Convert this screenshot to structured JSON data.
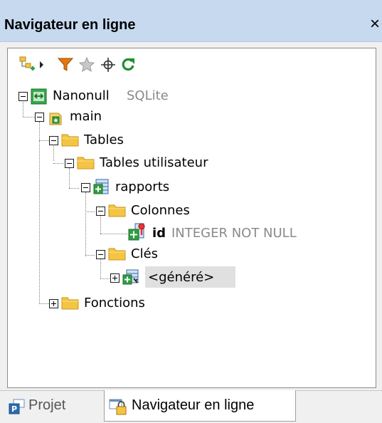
{
  "window": {
    "title": "Navigateur en ligne",
    "close_glyph": "×"
  },
  "toolbar": {
    "icons": [
      "add-object-icon",
      "dropdown-arrow-icon",
      "filter-icon",
      "favorites-star-icon",
      "locate-crosshair-icon",
      "refresh-icon"
    ]
  },
  "tree": {
    "nodes": [
      {
        "id": "nanonull",
        "label": "Nanonull",
        "suffix": "SQLite",
        "toggle": "minus",
        "icon": "database-connection-icon"
      },
      {
        "id": "main",
        "label": "main",
        "toggle": "minus",
        "icon": "schema-icon"
      },
      {
        "id": "tables",
        "label": "Tables",
        "toggle": "minus",
        "icon": "folder-icon"
      },
      {
        "id": "user-tables",
        "label": "Tables utilisateur",
        "toggle": "minus",
        "icon": "folder-icon"
      },
      {
        "id": "rapports",
        "label": "rapports",
        "toggle": "minus",
        "icon": "table-icon"
      },
      {
        "id": "colonnes",
        "label": "Colonnes",
        "toggle": "minus",
        "icon": "folder-icon"
      },
      {
        "id": "id",
        "label": "id",
        "suffix": "INTEGER NOT NULL",
        "toggle": "none",
        "icon": "primary-key-column-icon"
      },
      {
        "id": "cles",
        "label": "Clés",
        "toggle": "minus",
        "icon": "folder-icon"
      },
      {
        "id": "genere",
        "label": "<généré>",
        "toggle": "plus",
        "icon": "key-icon",
        "selected": true
      },
      {
        "id": "fonctions",
        "label": "Fonctions",
        "toggle": "plus",
        "icon": "folder-icon"
      }
    ]
  },
  "tabs": [
    {
      "label": "Projet",
      "active": false,
      "icon": "project-icon"
    },
    {
      "label": "Navigateur en ligne",
      "active": true,
      "icon": "online-browser-icon"
    }
  ],
  "colors": {
    "title_bg": "#c6d9ef",
    "folder": "#f4c542",
    "green": "#2e9e3e",
    "muted_text": "#8a8a8a",
    "selection": "#e0e0e0"
  }
}
